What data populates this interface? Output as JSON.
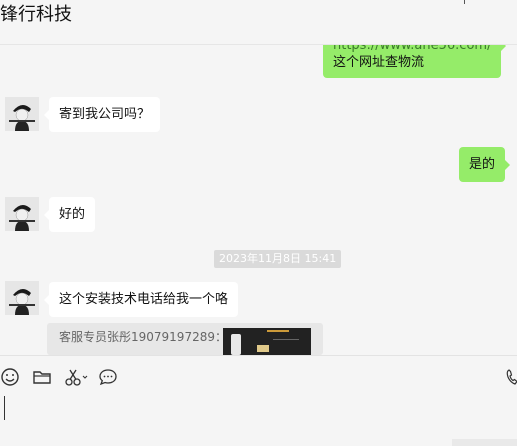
{
  "header": {
    "title": "锋行科技"
  },
  "messages": {
    "out1_url": "https://www.ane56.com/",
    "out1_text": "这个网址查物流",
    "in1": "寄到我公司吗？",
    "out2": "是的",
    "in2": "好的",
    "timestamp": "2023年11月8日 15:41",
    "in3": "这个安装技术电话给我一个咯",
    "quote": "客服专员张彤19079197289："
  },
  "toolbar": {
    "icons": [
      "emoji-icon",
      "folder-icon",
      "scissors-icon",
      "chat-bubble-icon",
      "phone-icon"
    ]
  },
  "colors": {
    "outgoing": "#95ec69",
    "incoming": "#ffffff",
    "background": "#f5f5f5"
  }
}
